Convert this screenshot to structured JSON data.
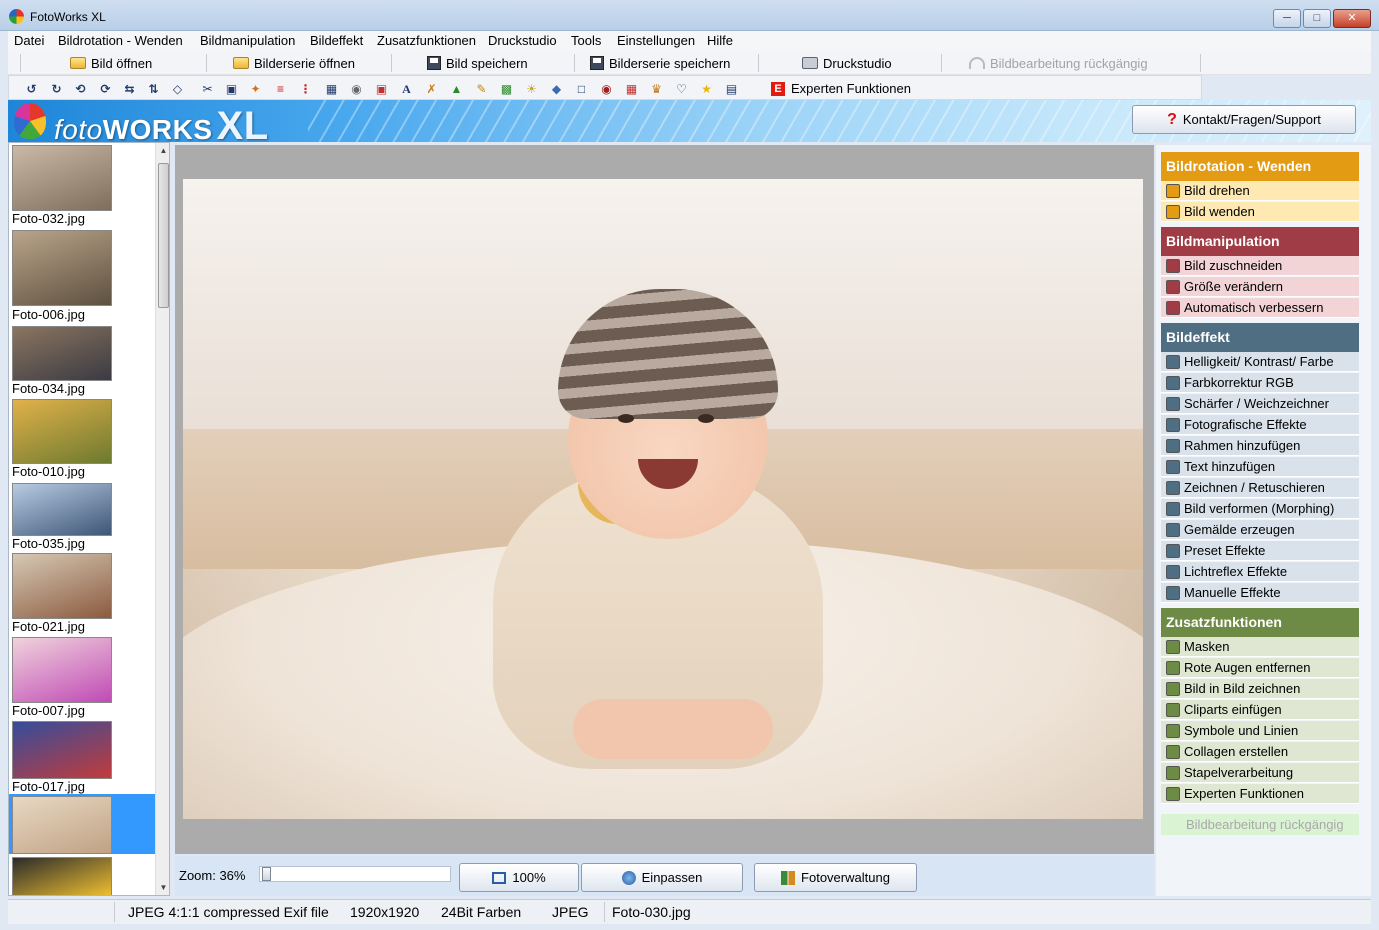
{
  "window": {
    "title": "FotoWorks XL"
  },
  "menu": [
    "Datei",
    "Bildrotation - Wenden",
    "Bildmanipulation",
    "Bildeffekt",
    "Zusatzfunktionen",
    "Druckstudio",
    "Tools",
    "Einstellungen",
    "Hilfe"
  ],
  "toolbar": {
    "open_image": "Bild öffnen",
    "open_series": "Bilderserie öffnen",
    "save_image": "Bild speichern",
    "save_series": "Bilderserie speichern",
    "print_studio": "Druckstudio",
    "undo": "Bildbearbeitung rückgängig",
    "expert": "Experten Funktionen"
  },
  "banner": {
    "logo_light": "foto",
    "logo_bold": "WORKS",
    "logo_xl": "XL",
    "support": "Kontakt/Fragen/Support"
  },
  "thumbnails": [
    {
      "name": "Foto-032.jpg",
      "colors": [
        "#c9b9a6",
        "#7f6e5c"
      ]
    },
    {
      "name": "Foto-006.jpg",
      "colors": [
        "#b9a489",
        "#5e5140"
      ]
    },
    {
      "name": "Foto-034.jpg",
      "colors": [
        "#8a7560",
        "#3b3a42"
      ]
    },
    {
      "name": "Foto-010.jpg",
      "colors": [
        "#e1b14a",
        "#6d7a2f"
      ]
    },
    {
      "name": "Foto-035.jpg",
      "colors": [
        "#b7cbe2",
        "#3e5677"
      ]
    },
    {
      "name": "Foto-021.jpg",
      "colors": [
        "#d6c8b5",
        "#8b5b3e"
      ]
    },
    {
      "name": "Foto-007.jpg",
      "colors": [
        "#f0d2dc",
        "#c04bb5"
      ]
    },
    {
      "name": "Foto-017.jpg",
      "colors": [
        "#344d9c",
        "#c23b3b"
      ]
    },
    {
      "name": "",
      "colors": [
        "#e8d8c4",
        "#c0a283"
      ]
    },
    {
      "name": "",
      "colors": [
        "#2b2b2b",
        "#f0c030"
      ]
    }
  ],
  "zoom": {
    "label": "Zoom: 36%",
    "value_pct": 36
  },
  "bottom_buttons": {
    "actual_size": "100%",
    "fit": "Einpassen",
    "manager": "Fotoverwaltung"
  },
  "panel": {
    "sections": [
      {
        "title": "Bildrotation - Wenden",
        "header_color": "#e39b14",
        "item_bg": "#fde9b1",
        "items": [
          {
            "label": "Bild drehen",
            "icon": "rotate-icon"
          },
          {
            "label": "Bild wenden",
            "icon": "flip-icon"
          }
        ]
      },
      {
        "title": "Bildmanipulation",
        "header_color": "#a03c45",
        "item_bg": "#f2d3d6",
        "items": [
          {
            "label": "Bild zuschneiden",
            "icon": "scissors-icon"
          },
          {
            "label": "Größe verändern",
            "icon": "resize-icon"
          },
          {
            "label": "Automatisch verbessern",
            "icon": "wand-icon"
          }
        ]
      },
      {
        "title": "Bildeffekt",
        "header_color": "#4f6e82",
        "item_bg": "#d9e2ea",
        "items": [
          {
            "label": "Helligkeit/ Kontrast/ Farbe",
            "icon": "sliders-icon"
          },
          {
            "label": "Farbkorrektur RGB",
            "icon": "rgb-icon"
          },
          {
            "label": "Schärfer / Weichzeichner",
            "icon": "sharpen-icon"
          },
          {
            "label": "Fotografische Effekte",
            "icon": "camera-icon"
          },
          {
            "label": "Rahmen hinzufügen",
            "icon": "frame-icon"
          },
          {
            "label": "Text hinzufügen",
            "icon": "text-icon"
          },
          {
            "label": "Zeichnen / Retuschieren",
            "icon": "draw-icon"
          },
          {
            "label": "Bild verformen (Morphing)",
            "icon": "morph-icon"
          },
          {
            "label": "Gemälde erzeugen",
            "icon": "paint-icon"
          },
          {
            "label": "Preset Effekte",
            "icon": "preset-icon"
          },
          {
            "label": "Lichtreflex Effekte",
            "icon": "light-icon"
          },
          {
            "label": "Manuelle Effekte",
            "icon": "manual-icon"
          }
        ]
      },
      {
        "title": "Zusatzfunktionen",
        "header_color": "#6d8b45",
        "item_bg": "#dfe7d2",
        "items": [
          {
            "label": "Masken",
            "icon": "mask-icon"
          },
          {
            "label": "Rote Augen entfernen",
            "icon": "eye-icon"
          },
          {
            "label": "Bild in Bild zeichnen",
            "icon": "pip-icon"
          },
          {
            "label": "Cliparts einfügen",
            "icon": "clipart-icon"
          },
          {
            "label": "Symbole und Linien",
            "icon": "symbols-icon"
          },
          {
            "label": "Collagen erstellen",
            "icon": "star-icon"
          },
          {
            "label": "Stapelverarbeitung",
            "icon": "batch-icon"
          },
          {
            "label": "Experten Funktionen",
            "icon": "expert-icon"
          }
        ]
      }
    ],
    "undo": "Bildbearbeitung rückgängig"
  },
  "status": {
    "format": "JPEG 4:1:1 compressed Exif file",
    "dimensions": "1920x1920",
    "depth": "24Bit Farben",
    "type": "JPEG",
    "filename": "Foto-030.jpg"
  }
}
